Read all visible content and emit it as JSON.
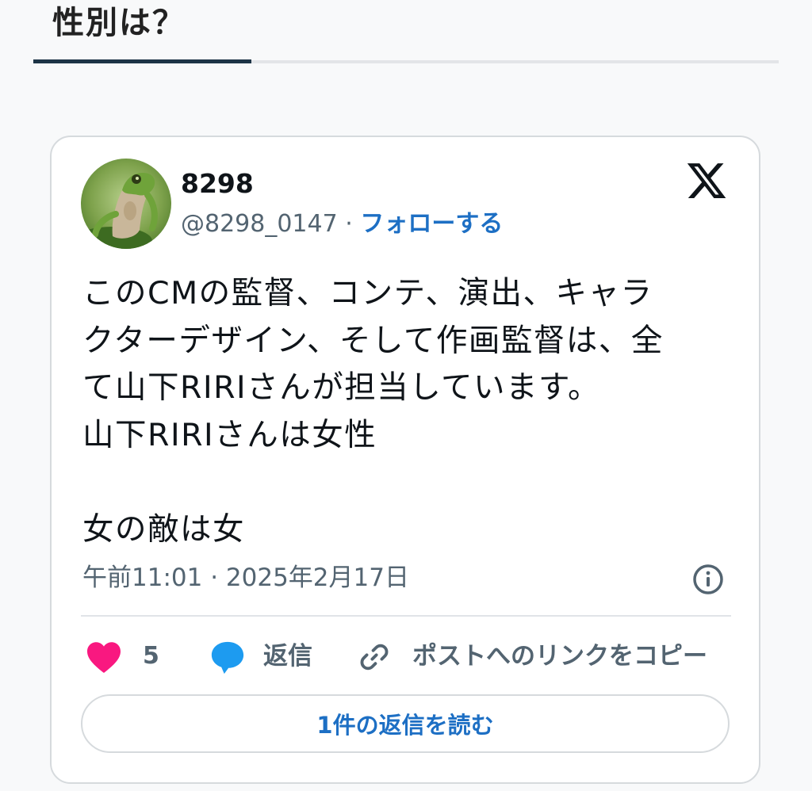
{
  "section": {
    "title": "性別は？"
  },
  "tweet": {
    "display_name": "8298",
    "handle": "@8298_0147",
    "separator": "·",
    "follow_label": "フォローする",
    "text_lines": [
      "このCMの監督、コンテ、演出、キャラ",
      "クターデザイン、そして作画監督は、全",
      "て山下RIRIさんが担当しています。",
      "山下RIRIさんは女性",
      "",
      "女の敵は女"
    ],
    "timestamp": "午前11:01 · 2025年2月17日"
  },
  "actions": {
    "like_count": "5",
    "reply_label": "返信",
    "copy_link_label": "ポストへのリンクをコピー"
  },
  "read_replies_label": "1件の返信を読む",
  "colors": {
    "accent": "#1d6fc4",
    "heart": "#f91880",
    "reply_bubble": "#1d9bf0",
    "tab_active": "#1d3446"
  }
}
